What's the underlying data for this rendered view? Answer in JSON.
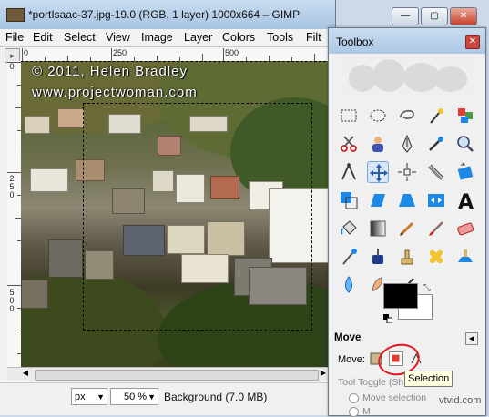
{
  "image_window": {
    "title": "*portIsaac-37.jpg-19.0 (RGB, 1 layer) 1000x664 – GIMP",
    "menu": [
      "File",
      "Edit",
      "Select",
      "View",
      "Image",
      "Layer",
      "Colors",
      "Tools",
      "Filt"
    ],
    "ruler_h_labels": [
      "0",
      "250",
      "500"
    ],
    "ruler_v_labels": [
      "0",
      "250",
      "500"
    ],
    "watermark_line1": "© 2011, Helen Bradley",
    "watermark_line2": "www.projectwoman.com",
    "status": {
      "unit": "px",
      "zoom": "50 %",
      "layer_info": "Background (7.0 MB)"
    }
  },
  "toolbox": {
    "title": "Toolbox",
    "tool_options_title": "Move",
    "move_label": "Move:",
    "tooltip": "Selection",
    "tool_toggle_label": "Tool Toggle  (Sh",
    "radio_1": "Move selection",
    "radio_2": "M"
  },
  "footer_site": "vtvid.com",
  "colors": {
    "foreground": "#000000",
    "background": "#ffffff",
    "annotation_red": "#e0191e"
  },
  "icons": [
    "rect-select-icon",
    "ellipse-select-icon",
    "lasso-icon",
    "fuzzy-select-icon",
    "by-color-select-icon",
    "scissors-icon",
    "foreground-select-icon",
    "paths-icon",
    "color-picker-icon",
    "zoom-icon",
    "measure-icon",
    "move-icon",
    "align-icon",
    "crop-icon",
    "rotate-icon",
    "scale-icon",
    "shear-icon",
    "perspective-icon",
    "flip-icon",
    "text-icon",
    "bucket-fill-icon",
    "blend-icon",
    "pencil-icon",
    "paintbrush-icon",
    "eraser-icon",
    "airbrush-icon",
    "ink-icon",
    "clone-icon",
    "heal-icon",
    "perspective-clone-icon",
    "blur-icon",
    "smudge-icon",
    "dodge-burn-icon"
  ]
}
